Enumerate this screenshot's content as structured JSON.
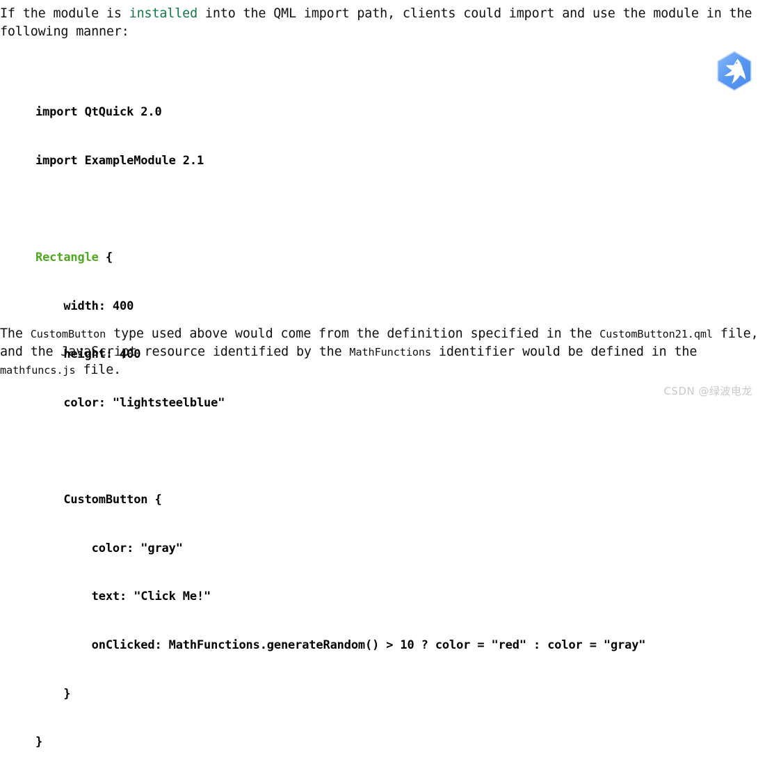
{
  "document": {
    "intro_paragraph": {
      "segment_1": "If the module is ",
      "link_word": "installed",
      "segment_2": " into the QML import path, clients could import and use the module in the following manner:"
    },
    "code_block": {
      "language": "qml",
      "lines": [
        "import QtQuick 2.0",
        "import ExampleModule 2.1",
        "",
        "Rectangle {",
        "    width: 400",
        "    height: 400",
        "    color: \"lightsteelblue\"",
        "",
        "    CustomButton {",
        "        color: \"gray\"",
        "        text: \"Click Me!\"",
        "        onClicked: MathFunctions.generateRandom() > 10 ? color = \"red\" : color = \"gray\"",
        "    }",
        "}"
      ],
      "line_1": "import QtQuick 2.0",
      "line_2": "import ExampleModule 2.1",
      "line_4_type": "Rectangle",
      "line_4_rest": " {",
      "line_5": "    width: 400",
      "line_6": "    height: 400",
      "line_7": "    color: \"lightsteelblue\"",
      "line_9": "    CustomButton {",
      "line_10": "        color: \"gray\"",
      "line_11": "        text: \"Click Me!\"",
      "line_12": "        onClicked: MathFunctions.generateRandom() > 10 ? color = \"red\" : color = \"gray\"",
      "line_13": "    }",
      "line_14": "}"
    },
    "closing_paragraph": {
      "segment_1": "The ",
      "code_1": "CustomButton",
      "segment_2": " type used above would come from the definition specified in the ",
      "code_2": "CustomButton21.qml",
      "segment_3": " file, and the JavaScript resource identified by the ",
      "code_3": "MathFunctions",
      "segment_4": " identifier would be defined in the ",
      "code_4": "mathfuncs.js",
      "segment_5": " file."
    }
  },
  "logo": {
    "name": "qt-kingfisher-logo",
    "hex_color": "#5596f0",
    "hex_color_light": "#87b4f5",
    "bird_color": "#ffffff"
  },
  "watermark": {
    "text": "CSDN @绿波电龙",
    "hex_color": "#c8c8c8"
  },
  "theme": {
    "background": "#ffffff",
    "text_color": "#101010",
    "link_green": "#117744",
    "type_green": "#4fa820",
    "code_color": "#000000"
  }
}
